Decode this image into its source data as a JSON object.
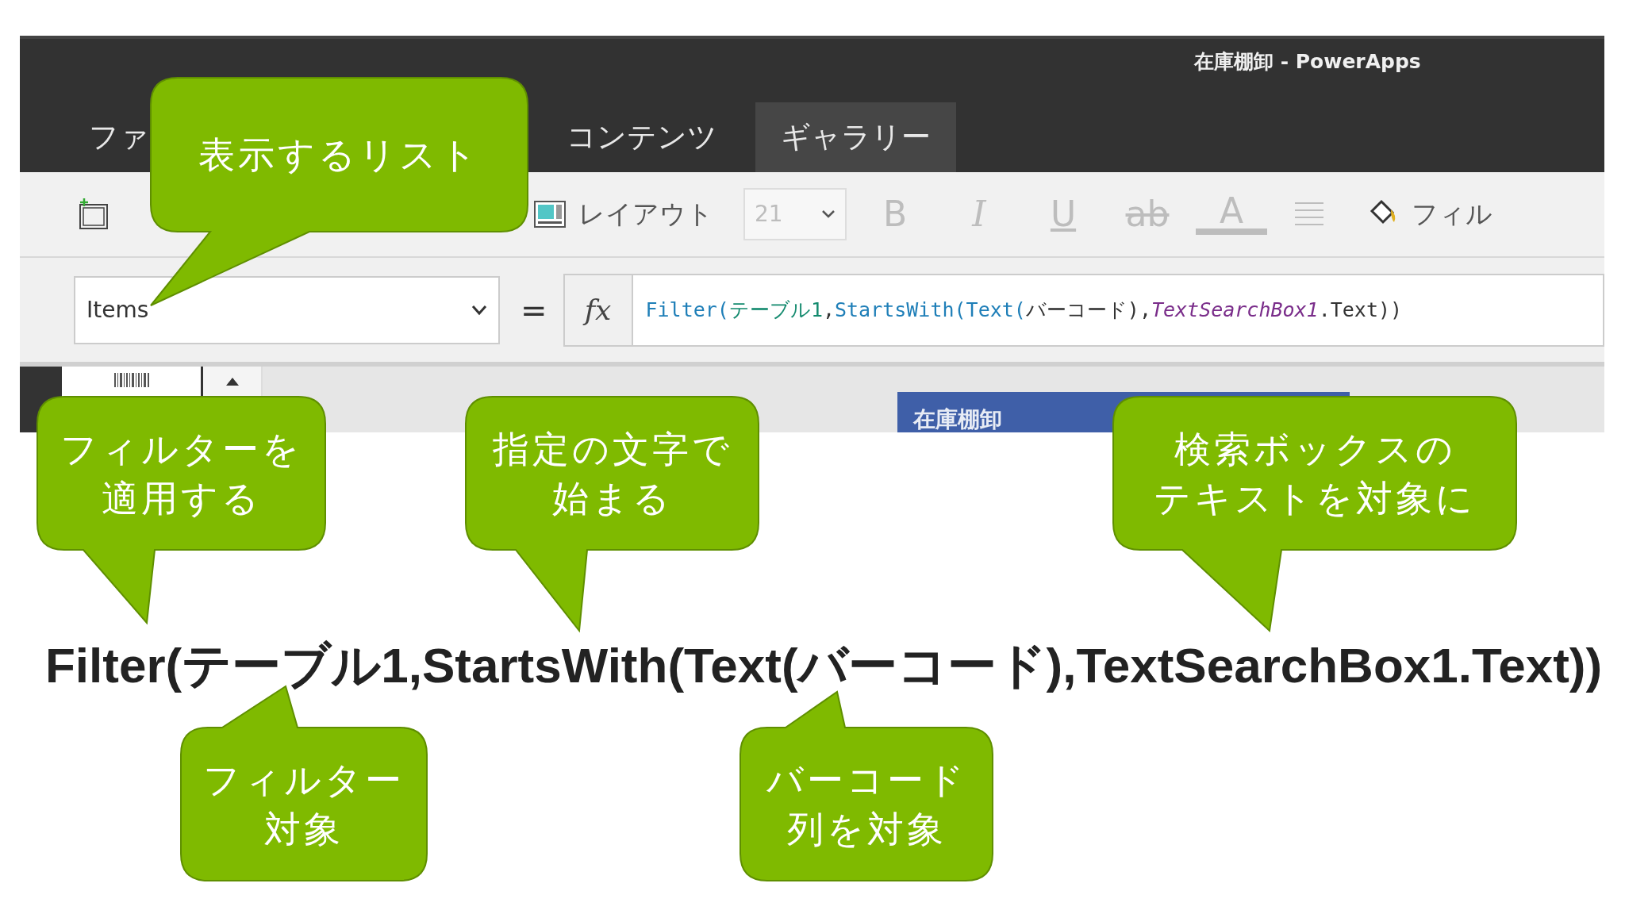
{
  "window": {
    "title": "在庫棚卸 - PowerApps"
  },
  "tabs": [
    {
      "label": "ファ",
      "selected": false
    },
    {
      "label": "コンテンツ",
      "selected": false
    },
    {
      "label": "ギャラリー",
      "selected": true
    }
  ],
  "toolbar": [
    {
      "kind": "new"
    },
    {
      "kind": "layout",
      "label": "レイアウト"
    },
    {
      "kind": "select",
      "value": "21",
      "disabled": true
    },
    {
      "kind": "format",
      "label": "B",
      "disabled": true
    },
    {
      "kind": "format",
      "label": "I",
      "disabled": true
    },
    {
      "kind": "format",
      "label": "U",
      "disabled": true
    },
    {
      "kind": "format",
      "label": "ab",
      "disabled": true
    },
    {
      "kind": "format",
      "label": "A",
      "disabled": true
    },
    {
      "kind": "align",
      "disabled": true
    },
    {
      "kind": "fill",
      "label": "フィル",
      "disabled": false
    }
  ],
  "formula_bar": {
    "property": "Items",
    "equals": "=",
    "fx": "fx",
    "formula": [
      {
        "kind": "function",
        "text": "Filter("
      },
      {
        "kind": "table",
        "text": "テーブル1"
      },
      {
        "kind": "plain",
        "text": ","
      },
      {
        "kind": "function",
        "text": "StartsWith("
      },
      {
        "kind": "function",
        "text": "Text("
      },
      {
        "kind": "plain",
        "text": "バーコード),"
      },
      {
        "kind": "control",
        "text": "TextSearchBox1"
      },
      {
        "kind": "plain",
        "text": ".Text))"
      }
    ]
  },
  "canvas": {
    "screen_title": "在庫棚卸"
  },
  "callouts": [
    {
      "lines": [
        "表示するリスト"
      ]
    },
    {
      "lines": [
        "フィルターを",
        "適用する"
      ]
    },
    {
      "lines": [
        "指定の文字で",
        "始まる"
      ]
    },
    {
      "lines": [
        "検索ボックスの",
        "テキストを対象に"
      ]
    },
    {
      "lines": [
        "フィルター",
        "対象"
      ]
    },
    {
      "lines": [
        "バーコード",
        "列を対象"
      ]
    }
  ],
  "expression": "Filter(テーブル1,StartsWith(Text(バーコード),TextSearchBox1.Text))"
}
